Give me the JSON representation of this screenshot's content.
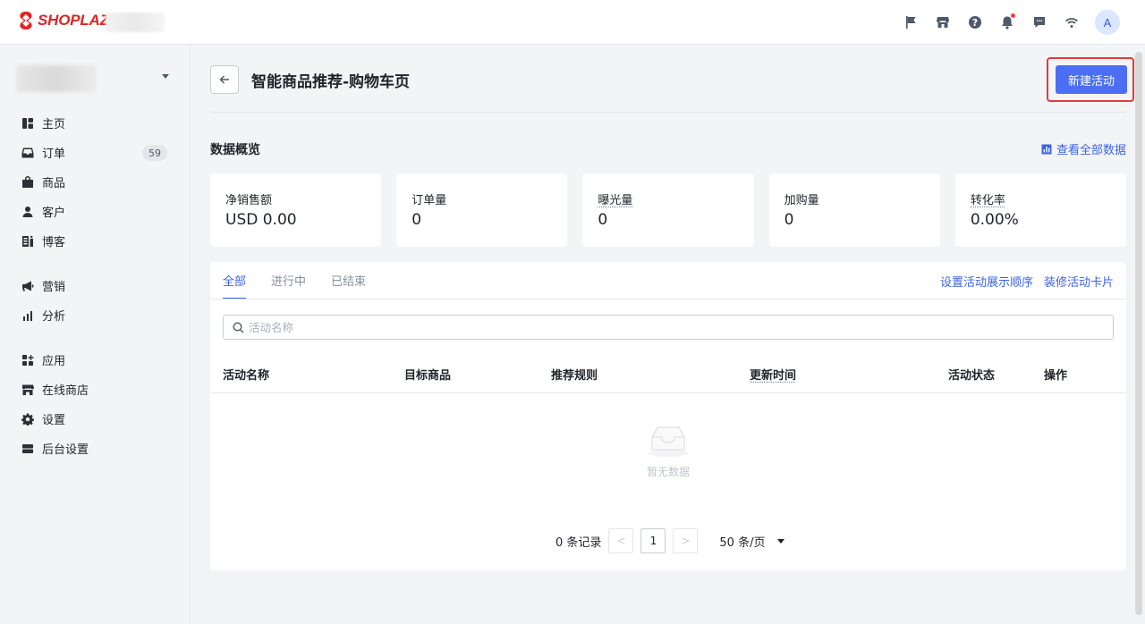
{
  "app": {
    "logo_text": "SHOPLAZZA",
    "avatar_initial": "A"
  },
  "topbar": {
    "icons": [
      "flag-icon",
      "store-icon",
      "help-icon",
      "bell-icon",
      "message-icon",
      "wifi-icon"
    ]
  },
  "sidebar": {
    "items": [
      {
        "label": "主页",
        "icon": "dashboard-icon"
      },
      {
        "label": "订单",
        "icon": "inbox-icon",
        "badge": "59"
      },
      {
        "label": "商品",
        "icon": "bag-icon"
      },
      {
        "label": "客户",
        "icon": "person-icon"
      },
      {
        "label": "博客",
        "icon": "blog-icon"
      },
      {
        "label": "营销",
        "icon": "megaphone-icon"
      },
      {
        "label": "分析",
        "icon": "bar-chart-icon"
      },
      {
        "label": "应用",
        "icon": "apps-icon"
      },
      {
        "label": "在线商店",
        "icon": "storefront-icon"
      },
      {
        "label": "设置",
        "icon": "gear-icon"
      },
      {
        "label": "后台设置",
        "icon": "server-icon"
      }
    ]
  },
  "header": {
    "title": "智能商品推荐-购物车页",
    "primary_button": "新建活动"
  },
  "overview": {
    "title": "数据概览",
    "view_all": "查看全部数据",
    "cards": [
      {
        "label": "净销售额",
        "value": "USD 0.00"
      },
      {
        "label": "订单量",
        "value": "0"
      },
      {
        "label": "曝光量",
        "value": "0"
      },
      {
        "label": "加购量",
        "value": "0"
      },
      {
        "label": "转化率",
        "value": "0.00%"
      }
    ]
  },
  "tabs": {
    "items": [
      "全部",
      "进行中",
      "已结束"
    ],
    "active": "全部",
    "link_order": "设置活动展示顺序",
    "link_decorate": "装修活动卡片"
  },
  "search": {
    "placeholder": "活动名称",
    "value": ""
  },
  "table": {
    "columns": [
      "活动名称",
      "目标商品",
      "推荐规则",
      "更新时间",
      "活动状态",
      "操作"
    ],
    "rows": [],
    "empty_text": "暂无数据"
  },
  "pagination": {
    "total_text": "0 条记录",
    "prev": "<",
    "page": "1",
    "next": ">",
    "page_size": "50 条/页"
  }
}
